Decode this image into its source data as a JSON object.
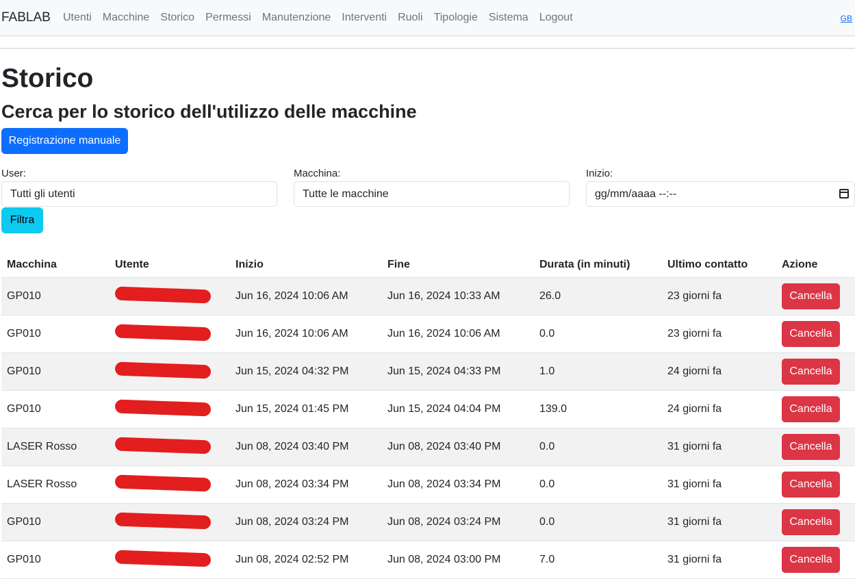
{
  "nav": {
    "brand": "FABLAB",
    "links": [
      "Utenti",
      "Macchine",
      "Storico",
      "Permessi",
      "Manutenzione",
      "Interventi",
      "Ruoli",
      "Tipologie",
      "Sistema",
      "Logout"
    ],
    "lang": "GB"
  },
  "page": {
    "title": "Storico",
    "subtitle": "Cerca per lo storico dell'utilizzo delle macchine",
    "manual_button": "Registrazione manuale"
  },
  "filters": {
    "user_label": "User:",
    "user_value": "Tutti gli utenti",
    "machine_label": "Macchina:",
    "machine_value": "Tutte le macchine",
    "start_label": "Inizio:",
    "start_placeholder": "gg/mm/aaaa --:--",
    "filter_button": "Filtra"
  },
  "table": {
    "headers": [
      "Macchina",
      "Utente",
      "Inizio",
      "Fine",
      "Durata (in minuti)",
      "Ultimo contatto",
      "Azione"
    ],
    "rows": [
      {
        "machine": "GP010",
        "start": "Jun 16, 2024 10:06 AM",
        "end": "Jun 16, 2024 10:33 AM",
        "duration": "26.0",
        "last": "23 giorni fa",
        "action": "Cancella"
      },
      {
        "machine": "GP010",
        "start": "Jun 16, 2024 10:06 AM",
        "end": "Jun 16, 2024 10:06 AM",
        "duration": "0.0",
        "last": "23 giorni fa",
        "action": "Cancella"
      },
      {
        "machine": "GP010",
        "start": "Jun 15, 2024 04:32 PM",
        "end": "Jun 15, 2024 04:33 PM",
        "duration": "1.0",
        "last": "24 giorni fa",
        "action": "Cancella"
      },
      {
        "machine": "GP010",
        "start": "Jun 15, 2024 01:45 PM",
        "end": "Jun 15, 2024 04:04 PM",
        "duration": "139.0",
        "last": "24 giorni fa",
        "action": "Cancella"
      },
      {
        "machine": "LASER Rosso",
        "start": "Jun 08, 2024 03:40 PM",
        "end": "Jun 08, 2024 03:40 PM",
        "duration": "0.0",
        "last": "31 giorni fa",
        "action": "Cancella"
      },
      {
        "machine": "LASER Rosso",
        "start": "Jun 08, 2024 03:34 PM",
        "end": "Jun 08, 2024 03:34 PM",
        "duration": "0.0",
        "last": "31 giorni fa",
        "action": "Cancella"
      },
      {
        "machine": "GP010",
        "start": "Jun 08, 2024 03:24 PM",
        "end": "Jun 08, 2024 03:24 PM",
        "duration": "0.0",
        "last": "31 giorni fa",
        "action": "Cancella"
      },
      {
        "machine": "GP010",
        "start": "Jun 08, 2024 02:52 PM",
        "end": "Jun 08, 2024 03:00 PM",
        "duration": "7.0",
        "last": "31 giorni fa",
        "action": "Cancella"
      }
    ]
  },
  "colors": {
    "primary": "#0d6efd",
    "info": "#0dcaf0",
    "danger": "#dc3545",
    "redaction": "#e31e1e"
  }
}
